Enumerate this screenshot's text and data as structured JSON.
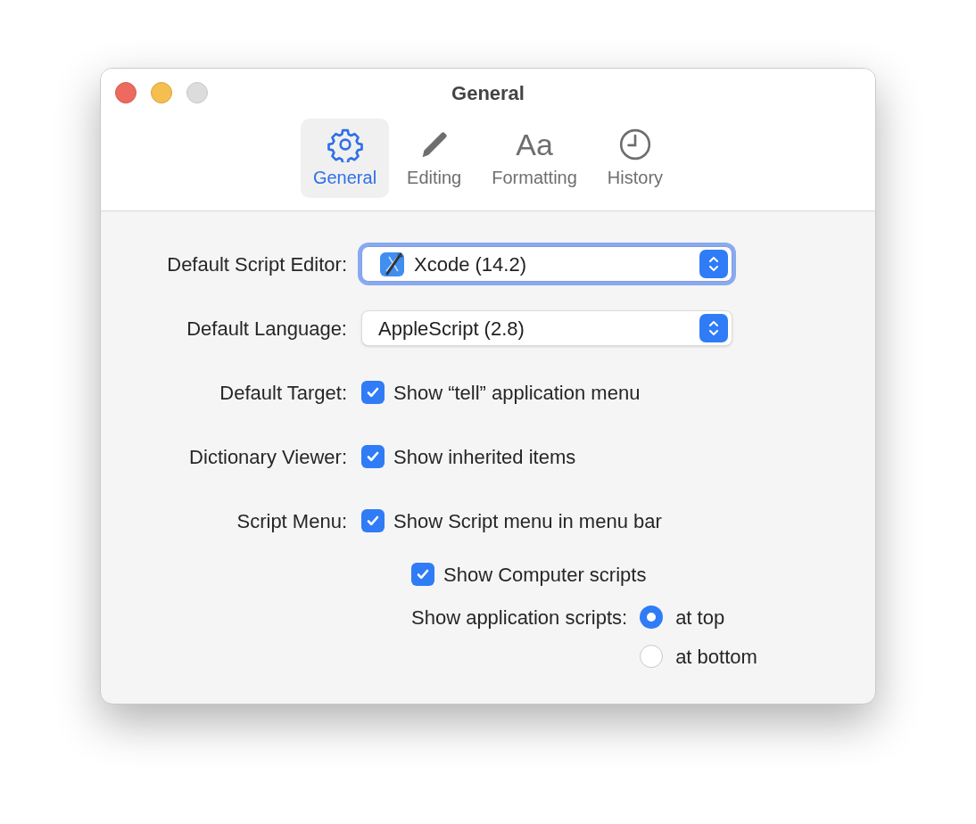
{
  "window": {
    "title": "General"
  },
  "tabs": [
    {
      "label": "General",
      "selected": true
    },
    {
      "label": "Editing",
      "selected": false
    },
    {
      "label": "Formatting",
      "glyph": "Aa",
      "selected": false
    },
    {
      "label": "History",
      "selected": false
    }
  ],
  "rows": [
    {
      "kind": "popup",
      "label": "Default Script Editor:",
      "value": "Xcode (14.2)",
      "focused": true
    },
    {
      "kind": "popup",
      "label": "Default Language:",
      "value": "AppleScript (2.8)",
      "focused": false
    },
    {
      "kind": "checkbox",
      "label": "Default Target:",
      "option": "Show “tell” application menu",
      "checked": true
    },
    {
      "kind": "checkbox",
      "label": "Dictionary Viewer:",
      "option": "Show inherited items",
      "checked": true
    },
    {
      "kind": "checkbox",
      "label": "Script Menu:",
      "option": "Show Script menu in menu bar",
      "checked": true,
      "children": [
        {
          "kind": "checkbox",
          "option": "Show Computer scripts",
          "checked": true
        },
        {
          "kind": "radio_group",
          "label": "Show application scripts:",
          "options": [
            {
              "label": "at top",
              "selected": true
            },
            {
              "label": "at bottom",
              "selected": false
            }
          ]
        }
      ]
    }
  ]
}
